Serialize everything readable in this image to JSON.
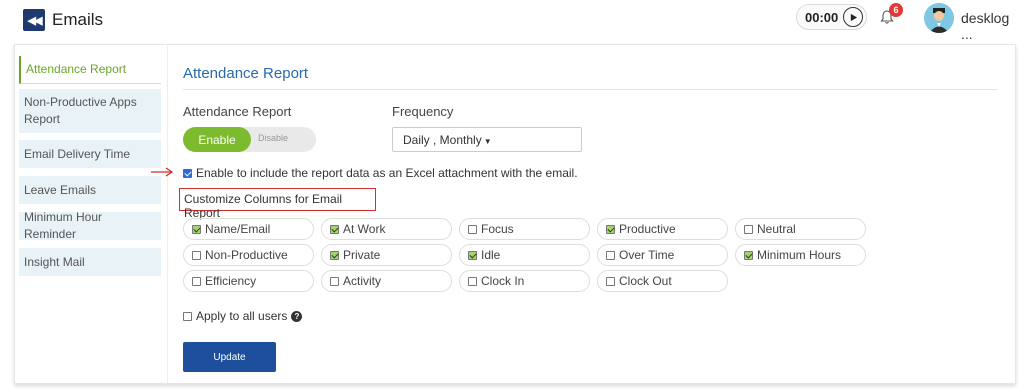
{
  "header": {
    "title": "Emails",
    "timer": "00:00",
    "notification_count": "6",
    "user_name": "desklog ..."
  },
  "sidebar": {
    "items": [
      {
        "label": "Attendance Report",
        "active": true
      },
      {
        "label": "Non-Productive Apps Report",
        "active": false
      },
      {
        "label": "Email Delivery Time",
        "active": false
      },
      {
        "label": "Leave Emails",
        "active": false
      },
      {
        "label": "Minimum Hour Reminder",
        "active": false
      },
      {
        "label": "Insight Mail",
        "active": false
      }
    ]
  },
  "main": {
    "title": "Attendance Report",
    "attendance_label": "Attendance Report",
    "toggle": {
      "on_label": "Enable",
      "off_label": "Disable"
    },
    "frequency_label": "Frequency",
    "frequency_value": "Daily , Monthly",
    "excel_label": "Enable to include the report data as an Excel attachment with the email.",
    "customize_label": "Customize Columns for Email Report",
    "columns": [
      {
        "label": "Name/Email",
        "checked": true
      },
      {
        "label": "At Work",
        "checked": true
      },
      {
        "label": "Focus",
        "checked": false
      },
      {
        "label": "Productive",
        "checked": true
      },
      {
        "label": "Neutral",
        "checked": false
      },
      {
        "label": "Non-Productive",
        "checked": false
      },
      {
        "label": "Private",
        "checked": true
      },
      {
        "label": "Idle",
        "checked": true
      },
      {
        "label": "Over Time",
        "checked": false
      },
      {
        "label": "Minimum Hours",
        "checked": true
      },
      {
        "label": "Efficiency",
        "checked": false
      },
      {
        "label": "Activity",
        "checked": false
      },
      {
        "label": "Clock In",
        "checked": false
      },
      {
        "label": "Clock Out",
        "checked": false
      }
    ],
    "apply_all_label": "Apply to all users",
    "update_label": "Update"
  },
  "colors": {
    "accent_green": "#7dbb2e",
    "primary_blue": "#1e4f9c",
    "title_blue": "#2a6aa8",
    "highlight_red": "#d32f2f"
  }
}
